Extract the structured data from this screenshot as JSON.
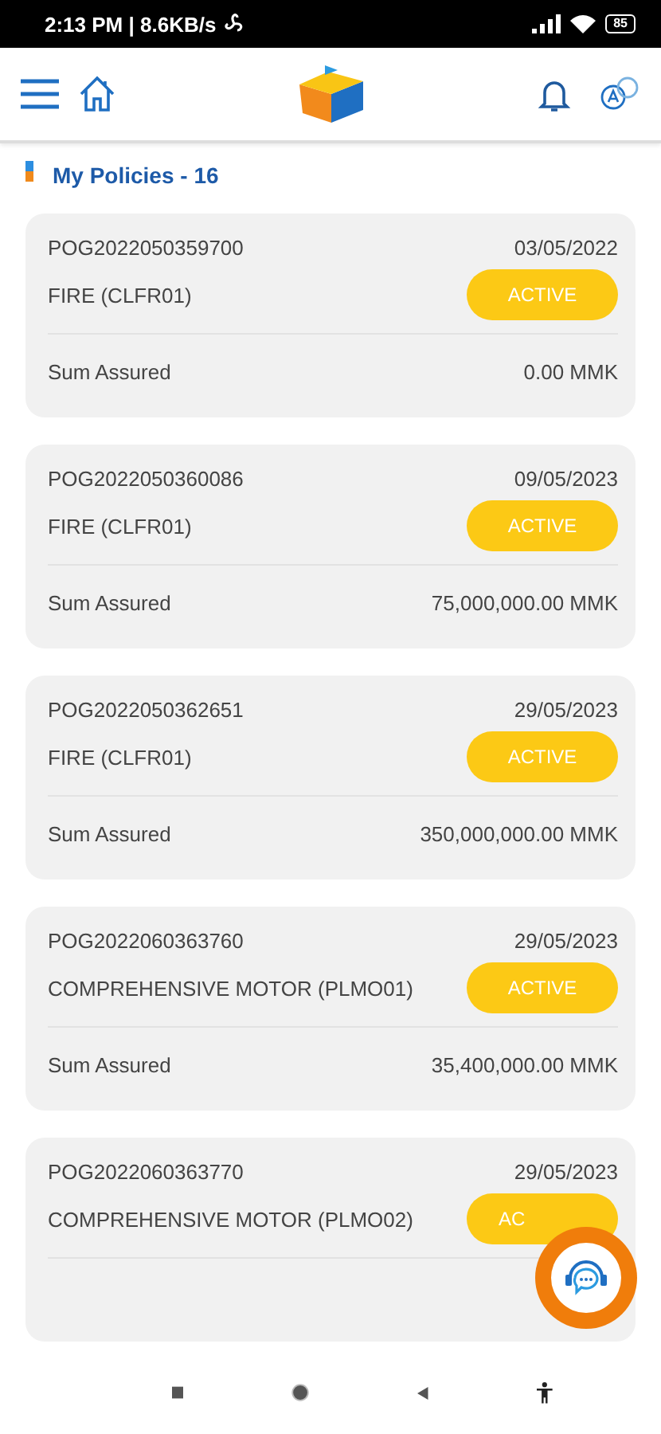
{
  "status_bar": {
    "time": "2:13 PM | 8.6KB/s",
    "battery": "85"
  },
  "title": "My Policies - 16",
  "policies": [
    {
      "number": "POG2022050359700",
      "date": "03/05/2022",
      "product": "FIRE (CLFR01)",
      "status": "ACTIVE",
      "sum_label": "Sum Assured",
      "sum": "0.00 MMK"
    },
    {
      "number": "POG2022050360086",
      "date": "09/05/2023",
      "product": "FIRE (CLFR01)",
      "status": "ACTIVE",
      "sum_label": "Sum Assured",
      "sum": "75,000,000.00 MMK"
    },
    {
      "number": "POG2022050362651",
      "date": "29/05/2023",
      "product": "FIRE (CLFR01)",
      "status": "ACTIVE",
      "sum_label": "Sum Assured",
      "sum": "350,000,000.00 MMK"
    },
    {
      "number": "POG2022060363760",
      "date": "29/05/2023",
      "product": "COMPREHENSIVE MOTOR (PLMO01)",
      "status": "ACTIVE",
      "sum_label": "Sum Assured",
      "sum": "35,400,000.00 MMK"
    },
    {
      "number": "POG2022060363770",
      "date": "29/05/2023",
      "product": "COMPREHENSIVE MOTOR (PLMO02)",
      "status": "AC"
    }
  ]
}
